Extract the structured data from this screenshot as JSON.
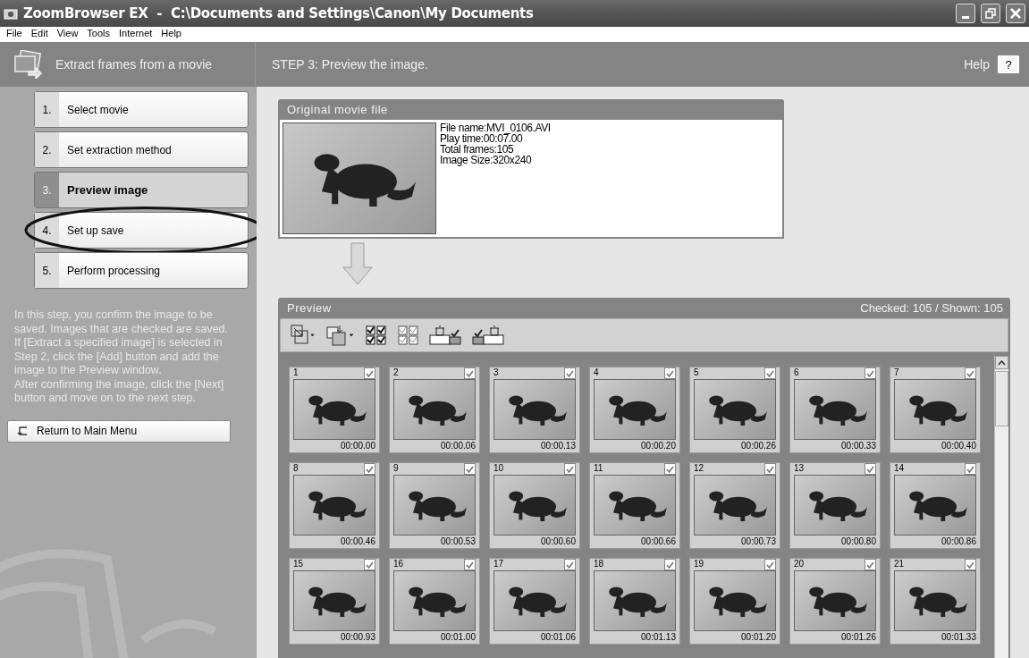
{
  "window": {
    "title": "ZoomBrowser EX  -  C:\\Documents and Settings\\Canon\\My Documents"
  },
  "menu": [
    "File",
    "Edit",
    "View",
    "Tools",
    "Internet",
    "Help"
  ],
  "sidebar": {
    "title": "Extract frames from a movie",
    "steps": [
      {
        "number": "1.",
        "label": "Select movie",
        "selected": false,
        "circled": false
      },
      {
        "number": "2.",
        "label": "Set extraction method",
        "selected": false,
        "circled": false
      },
      {
        "number": "3.",
        "label": "Preview image",
        "selected": true,
        "circled": false
      },
      {
        "number": "4.",
        "label": "Set up save",
        "selected": false,
        "circled": true
      },
      {
        "number": "5.",
        "label": "Perform processing",
        "selected": false,
        "circled": false
      }
    ],
    "description": [
      "In this step, you confirm the image to be saved. Images that are checked are saved.",
      "If [Extract a specified image] is selected in Step 2, click the [Add] button and add the image to the Preview window.",
      "After confirming the image, click the [Next] button and move on to the next step."
    ],
    "return_button": "Return to Main Menu"
  },
  "header": {
    "step_title": "STEP 3: Preview the image.",
    "help": "Help",
    "help_button": "?"
  },
  "original": {
    "title": "Original movie file",
    "info": [
      "File name:MVI_0106.AVI",
      "Play time:00:07.00",
      "Total frames:105",
      "Image Size:320x240"
    ]
  },
  "preview": {
    "title": "Preview",
    "status": "Checked: 105 / Shown: 105",
    "frames": [
      {
        "number": "1",
        "time": "00:00.00",
        "checked": true
      },
      {
        "number": "2",
        "time": "00:00.06",
        "checked": true
      },
      {
        "number": "3",
        "time": "00:00.13",
        "checked": true
      },
      {
        "number": "4",
        "time": "00:00.20",
        "checked": true
      },
      {
        "number": "5",
        "time": "00:00.26",
        "checked": true
      },
      {
        "number": "6",
        "time": "00:00.33",
        "checked": true
      },
      {
        "number": "7",
        "time": "00:00.40",
        "checked": true
      },
      {
        "number": "8",
        "time": "00:00.46",
        "checked": true
      },
      {
        "number": "9",
        "time": "00:00.53",
        "checked": true
      },
      {
        "number": "10",
        "time": "00:00.60",
        "checked": true
      },
      {
        "number": "11",
        "time": "00:00.66",
        "checked": true
      },
      {
        "number": "12",
        "time": "00:00.73",
        "checked": true
      },
      {
        "number": "13",
        "time": "00:00.80",
        "checked": true
      },
      {
        "number": "14",
        "time": "00:00.86",
        "checked": true
      },
      {
        "number": "15",
        "time": "00:00.93",
        "checked": true
      },
      {
        "number": "16",
        "time": "00:01.00",
        "checked": true
      },
      {
        "number": "17",
        "time": "00:01.06",
        "checked": true
      },
      {
        "number": "18",
        "time": "00:01.13",
        "checked": true
      },
      {
        "number": "19",
        "time": "00:01.20",
        "checked": true
      },
      {
        "number": "20",
        "time": "00:01.26",
        "checked": true
      },
      {
        "number": "21",
        "time": "00:01.33",
        "checked": true
      }
    ]
  }
}
